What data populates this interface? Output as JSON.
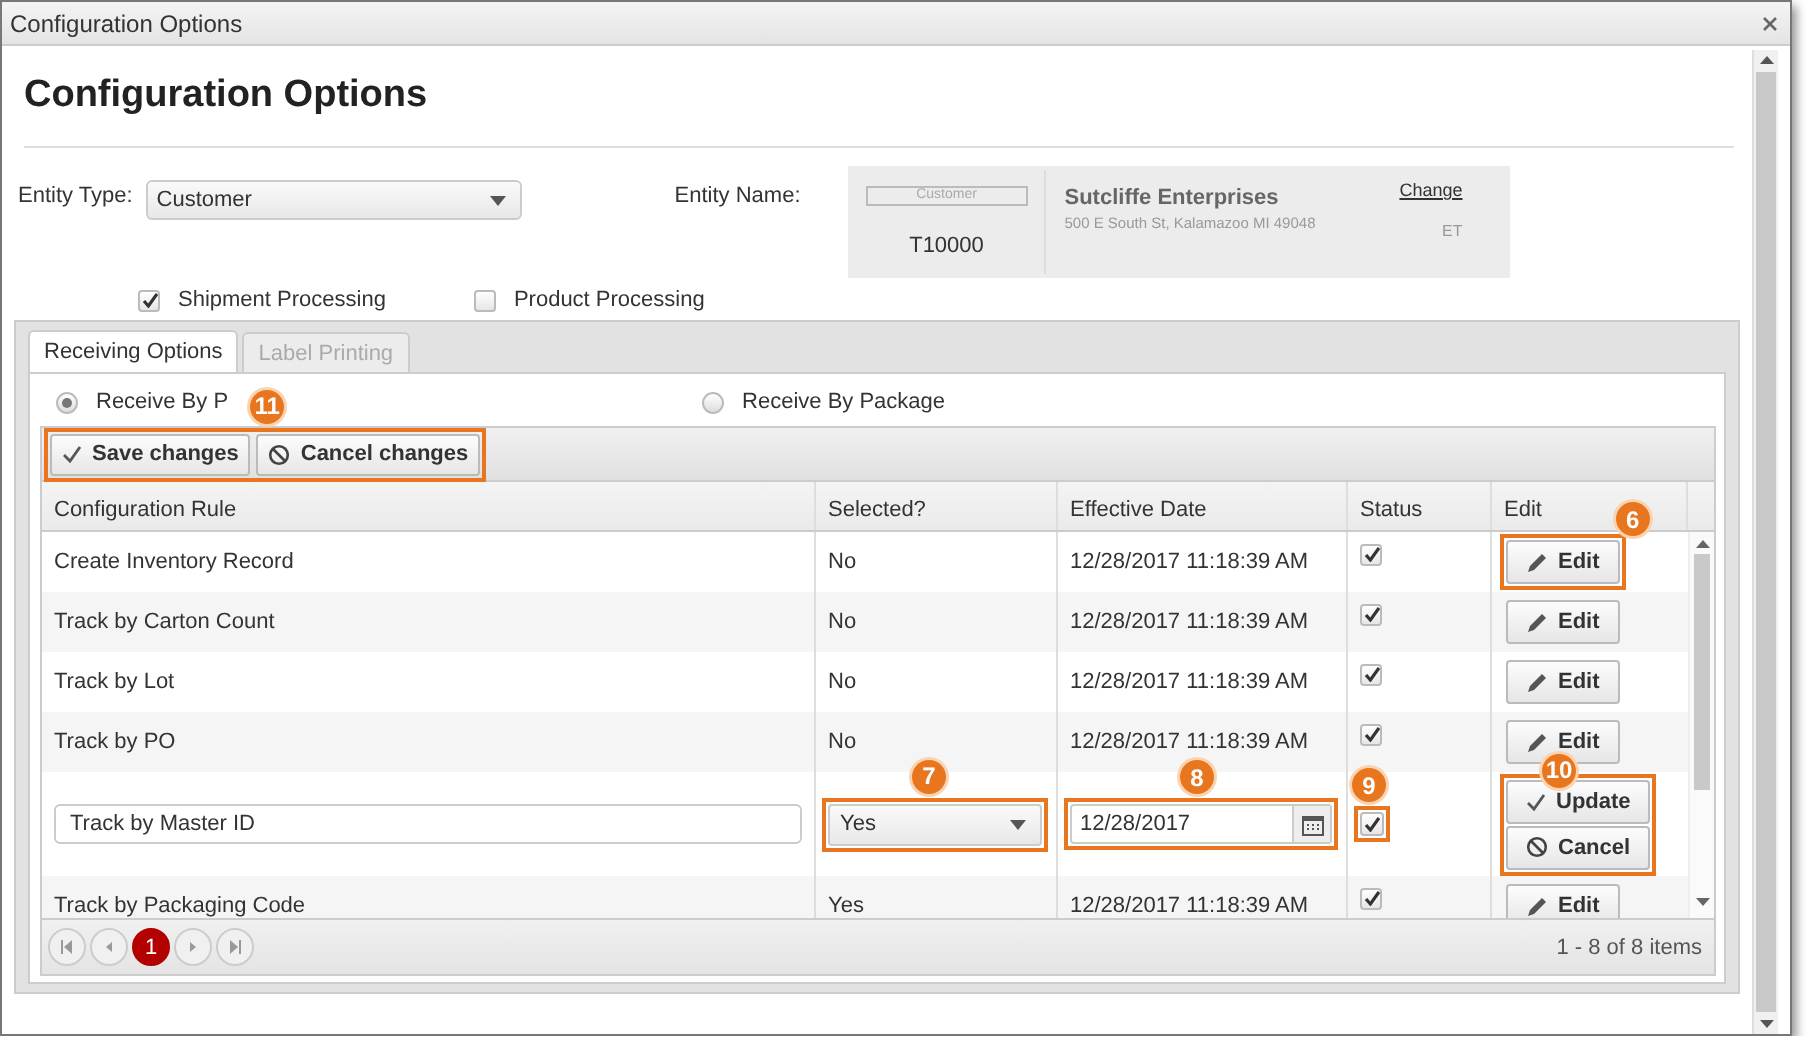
{
  "window": {
    "title": "Configuration Options"
  },
  "heading": "Configuration Options",
  "entity_type": {
    "label": "Entity Type:",
    "value": "Customer"
  },
  "entity_name": {
    "label": "Entity Name:",
    "type_tag": "Customer",
    "code": "T10000",
    "name": "Sutcliffe Enterprises",
    "address": "500 E South St, Kalamazoo MI 49048",
    "change_link": "Change",
    "initials": "ET"
  },
  "processing": [
    {
      "label": "Shipment Processing",
      "checked": true
    },
    {
      "label": "Product Processing",
      "checked": false
    }
  ],
  "tabs": [
    {
      "label": "Receiving Options",
      "selected": true,
      "disabled": false
    },
    {
      "label": "Label Printing",
      "selected": false,
      "disabled": true
    }
  ],
  "receive_mode": [
    {
      "label": "Receive By P",
      "selected": true
    },
    {
      "label": "Receive By Package",
      "selected": false
    }
  ],
  "toolbar": {
    "callout": "11",
    "buttons": [
      {
        "kind": "save",
        "label": "Save changes"
      },
      {
        "kind": "cancel",
        "label": "Cancel changes"
      }
    ]
  },
  "columns": [
    "Configuration Rule",
    "Selected?",
    "Effective Date",
    "Status",
    "Edit"
  ],
  "rows": [
    {
      "kind": "view",
      "rule": "Create Inventory Record",
      "selected_value": "No",
      "date": "12/28/2017 11:18:39 AM",
      "status": true,
      "buttons": [
        {
          "kind": "edit",
          "label": "Edit"
        }
      ],
      "callout": "6"
    },
    {
      "kind": "view",
      "rule": "Track by Carton Count",
      "selected_value": "No",
      "date": "12/28/2017 11:18:39 AM",
      "status": true,
      "buttons": [
        {
          "kind": "edit",
          "label": "Edit"
        }
      ]
    },
    {
      "kind": "view",
      "rule": "Track by Lot",
      "selected_value": "No",
      "date": "12/28/2017 11:18:39 AM",
      "status": true,
      "buttons": [
        {
          "kind": "edit",
          "label": "Edit"
        }
      ]
    },
    {
      "kind": "view",
      "rule": "Track by PO",
      "selected_value": "No",
      "date": "12/28/2017 11:18:39 AM",
      "status": true,
      "buttons": [
        {
          "kind": "edit",
          "label": "Edit"
        }
      ]
    },
    {
      "kind": "edit",
      "rule": "Track by Master ID",
      "selected_value": "Yes",
      "date": "12/28/2017",
      "status": true,
      "buttons": [
        {
          "kind": "update",
          "label": "Update"
        },
        {
          "kind": "cancel",
          "label": "Cancel"
        }
      ],
      "callouts": {
        "selected": "7",
        "date": "8",
        "status": "9",
        "buttons": "10"
      }
    },
    {
      "kind": "view",
      "rule": "Track by Packaging Code",
      "selected_value": "Yes",
      "date": "12/28/2017 11:18:39 AM",
      "status": true,
      "buttons": [
        {
          "kind": "edit",
          "label": "Edit"
        }
      ]
    }
  ],
  "pager": {
    "pages": [
      {
        "label": "1",
        "selected": true
      }
    ],
    "info": "1 - 8 of 8 items"
  }
}
